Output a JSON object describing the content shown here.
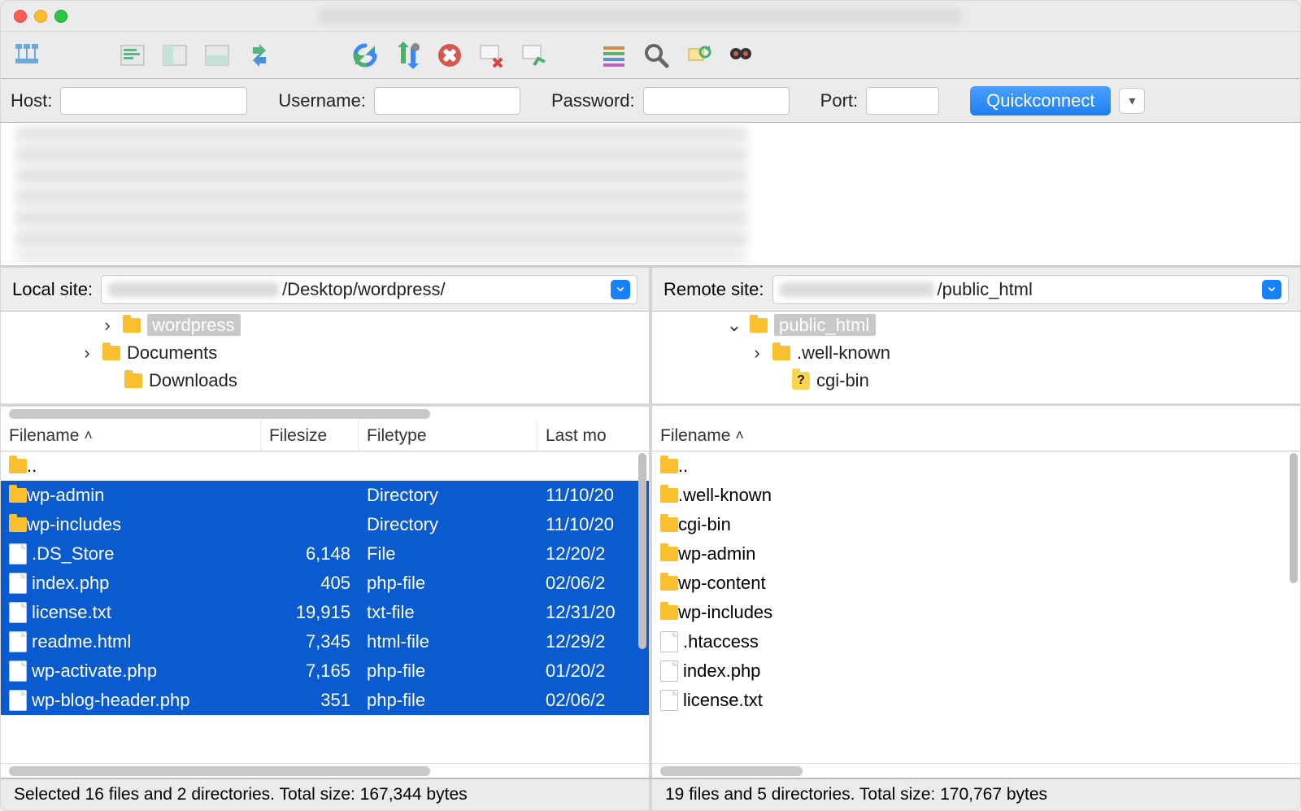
{
  "quickconnect": {
    "host_label": "Host:",
    "username_label": "Username:",
    "password_label": "Password:",
    "port_label": "Port:",
    "button_label": "Quickconnect"
  },
  "local": {
    "site_label": "Local site:",
    "path_visible": "/Desktop/wordpress/",
    "tree": [
      {
        "arrow": "›",
        "indent": 120,
        "name": "wordpress",
        "selected": true,
        "icon": "folder"
      },
      {
        "arrow": "›",
        "indent": 95,
        "name": "Documents",
        "selected": false,
        "icon": "folder"
      },
      {
        "arrow": "",
        "indent": 122,
        "name": "Downloads",
        "selected": false,
        "icon": "folder"
      }
    ],
    "columns": {
      "filename": "Filename",
      "filesize": "Filesize",
      "filetype": "Filetype",
      "lastmod": "Last mo"
    },
    "files": [
      {
        "name": "..",
        "size": "",
        "type": "",
        "date": "",
        "icon": "folder",
        "selected": false
      },
      {
        "name": "wp-admin",
        "size": "",
        "type": "Directory",
        "date": "11/10/20",
        "icon": "folder",
        "selected": true
      },
      {
        "name": "wp-includes",
        "size": "",
        "type": "Directory",
        "date": "11/10/20",
        "icon": "folder",
        "selected": true
      },
      {
        "name": ".DS_Store",
        "size": "6,148",
        "type": "File",
        "date": "12/20/2",
        "icon": "file",
        "selected": true
      },
      {
        "name": "index.php",
        "size": "405",
        "type": "php-file",
        "date": "02/06/2",
        "icon": "file",
        "selected": true
      },
      {
        "name": "license.txt",
        "size": "19,915",
        "type": "txt-file",
        "date": "12/31/20",
        "icon": "file",
        "selected": true
      },
      {
        "name": "readme.html",
        "size": "7,345",
        "type": "html-file",
        "date": "12/29/2",
        "icon": "file",
        "selected": true
      },
      {
        "name": "wp-activate.php",
        "size": "7,165",
        "type": "php-file",
        "date": "01/20/2",
        "icon": "file",
        "selected": true
      },
      {
        "name": "wp-blog-header.php",
        "size": "351",
        "type": "php-file",
        "date": "02/06/2",
        "icon": "file",
        "selected": true
      }
    ],
    "status": "Selected 16 files and 2 directories. Total size: 167,344 bytes"
  },
  "remote": {
    "site_label": "Remote site:",
    "path_visible": "/public_html",
    "tree": [
      {
        "arrow": "⌄",
        "indent": 90,
        "name": "public_html",
        "selected": true,
        "icon": "folder"
      },
      {
        "arrow": "›",
        "indent": 118,
        "name": ".well-known",
        "selected": false,
        "icon": "folder"
      },
      {
        "arrow": "",
        "indent": 142,
        "name": "cgi-bin",
        "selected": false,
        "icon": "question"
      }
    ],
    "columns": {
      "filename": "Filename"
    },
    "files": [
      {
        "name": "..",
        "icon": "folder"
      },
      {
        "name": ".well-known",
        "icon": "folder"
      },
      {
        "name": "cgi-bin",
        "icon": "folder"
      },
      {
        "name": "wp-admin",
        "icon": "folder"
      },
      {
        "name": "wp-content",
        "icon": "folder"
      },
      {
        "name": "wp-includes",
        "icon": "folder"
      },
      {
        "name": ".htaccess",
        "icon": "file"
      },
      {
        "name": "index.php",
        "icon": "file"
      },
      {
        "name": "license.txt",
        "icon": "file"
      }
    ],
    "status": "19 files and 5 directories. Total size: 170,767 bytes"
  },
  "colors": {
    "selection": "#0a5ad0",
    "accent": "#1681ff",
    "folder": "#fbc02f"
  }
}
